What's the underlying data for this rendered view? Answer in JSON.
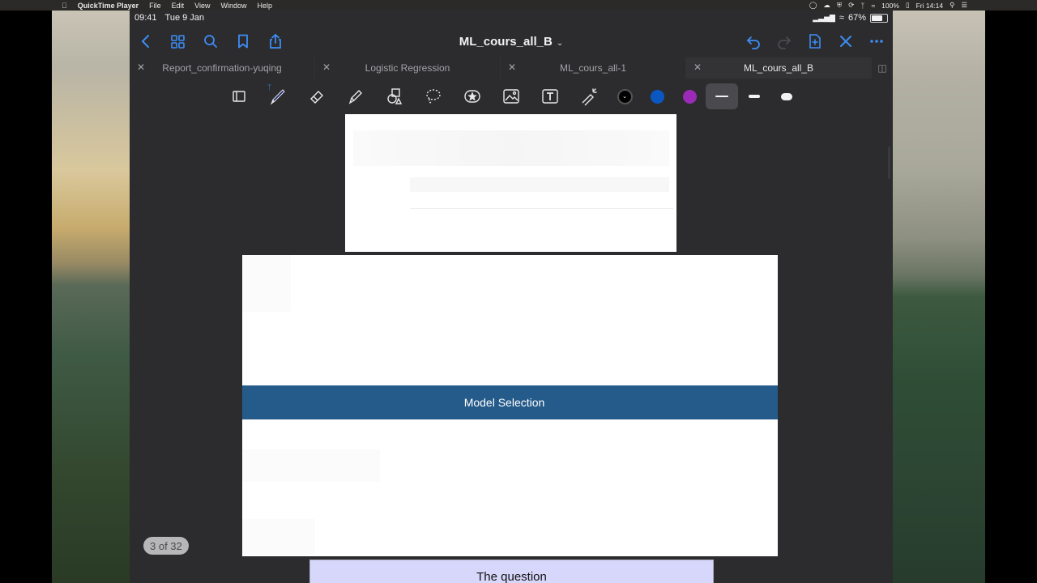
{
  "mac_menubar": {
    "app_name": "QuickTime Player",
    "menus": [
      "File",
      "Edit",
      "View",
      "Window",
      "Help"
    ],
    "battery": "100%",
    "clock": "Fri 14:14"
  },
  "ipad_status": {
    "time": "09:41",
    "date": "Tue 9 Jan",
    "battery": "67%"
  },
  "document": {
    "title": "ML_cours_all_B"
  },
  "tabs": [
    {
      "label": "Report_confirmation-yuqing",
      "active": false
    },
    {
      "label": "Logistic Regression",
      "active": false
    },
    {
      "label": "ML_cours_all-1",
      "active": false
    },
    {
      "label": "ML_cours_all_B",
      "active": true
    }
  ],
  "toolbar": {
    "tools": [
      "selection-tool-icon",
      "pen-icon",
      "eraser-icon",
      "highlighter-icon",
      "shapes-icon",
      "lasso-icon",
      "elements-icon",
      "image-icon",
      "text-icon",
      "laser-pointer-icon"
    ],
    "colors": [
      "#000000",
      "#0a57c2",
      "#9b2bb6"
    ],
    "active_color": "#000000"
  },
  "slide": {
    "section_title": "Model Selection"
  },
  "next_slide": {
    "title": "The question"
  },
  "page_indicator": "3 of 32"
}
